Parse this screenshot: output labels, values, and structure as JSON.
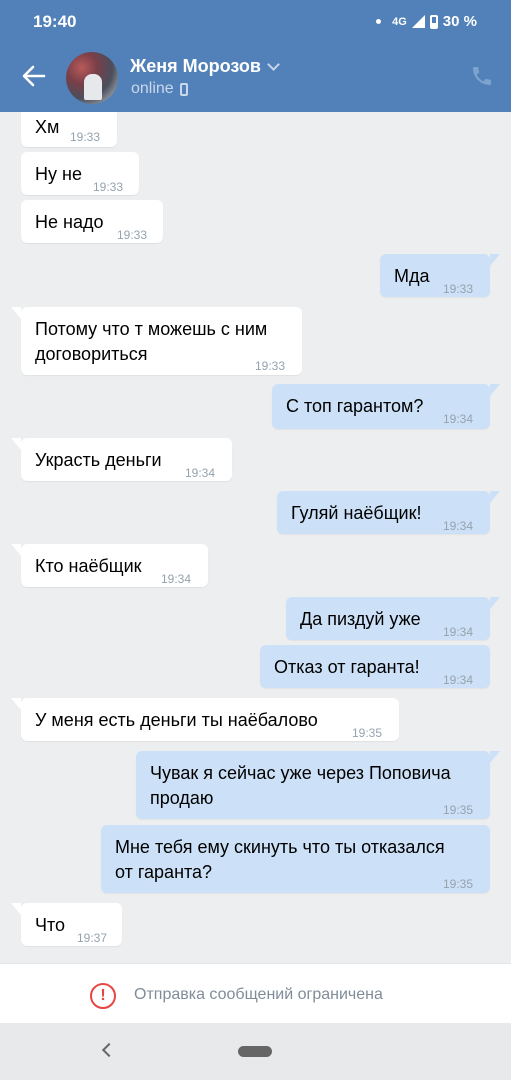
{
  "statusbar": {
    "time": "19:40",
    "network": "4G",
    "battery": "30 %"
  },
  "header": {
    "contact_name": "Женя Морозов",
    "status": "online"
  },
  "messages": [
    {
      "dir": "in",
      "lines": [
        "Хм"
      ],
      "time": "19:33"
    },
    {
      "dir": "in",
      "lines": [
        "Ну не"
      ],
      "time": "19:33"
    },
    {
      "dir": "in",
      "lines": [
        "Не надо"
      ],
      "time": "19:33"
    },
    {
      "dir": "out",
      "lines": [
        "Мда"
      ],
      "time": "19:33"
    },
    {
      "dir": "in",
      "lines": [
        "Потому что т можешь с ним",
        "договориться"
      ],
      "time": "19:33"
    },
    {
      "dir": "out",
      "lines": [
        "С топ гарантом?"
      ],
      "time": "19:34"
    },
    {
      "dir": "in",
      "lines": [
        "Украсть деньги"
      ],
      "time": "19:34"
    },
    {
      "dir": "out",
      "lines": [
        "Гуляй наёбщик!"
      ],
      "time": "19:34"
    },
    {
      "dir": "in",
      "lines": [
        "Кто наёбщик"
      ],
      "time": "19:34"
    },
    {
      "dir": "out",
      "lines": [
        "Да пиздуй уже"
      ],
      "time": "19:34"
    },
    {
      "dir": "out",
      "lines": [
        "Отказ от гаранта!"
      ],
      "time": "19:34"
    },
    {
      "dir": "in",
      "lines": [
        "У меня есть деньги ты наёбалово"
      ],
      "time": "19:35"
    },
    {
      "dir": "out",
      "lines": [
        "Чувак я сейчас уже через Поповича",
        "продаю"
      ],
      "time": "19:35"
    },
    {
      "dir": "out",
      "lines": [
        "Мне тебя ему скинуть что ты отказался",
        "от гаранта?"
      ],
      "time": "19:35"
    },
    {
      "dir": "in",
      "lines": [
        "Что"
      ],
      "time": "19:37"
    }
  ],
  "restriction": {
    "text": "Отправка сообщений ограничена",
    "icon": "warning-icon",
    "color": "#e64646"
  },
  "colors": {
    "header": "#5181b8",
    "incoming": "#ffffff",
    "outgoing": "#cce1f7",
    "background": "#edeef0"
  }
}
